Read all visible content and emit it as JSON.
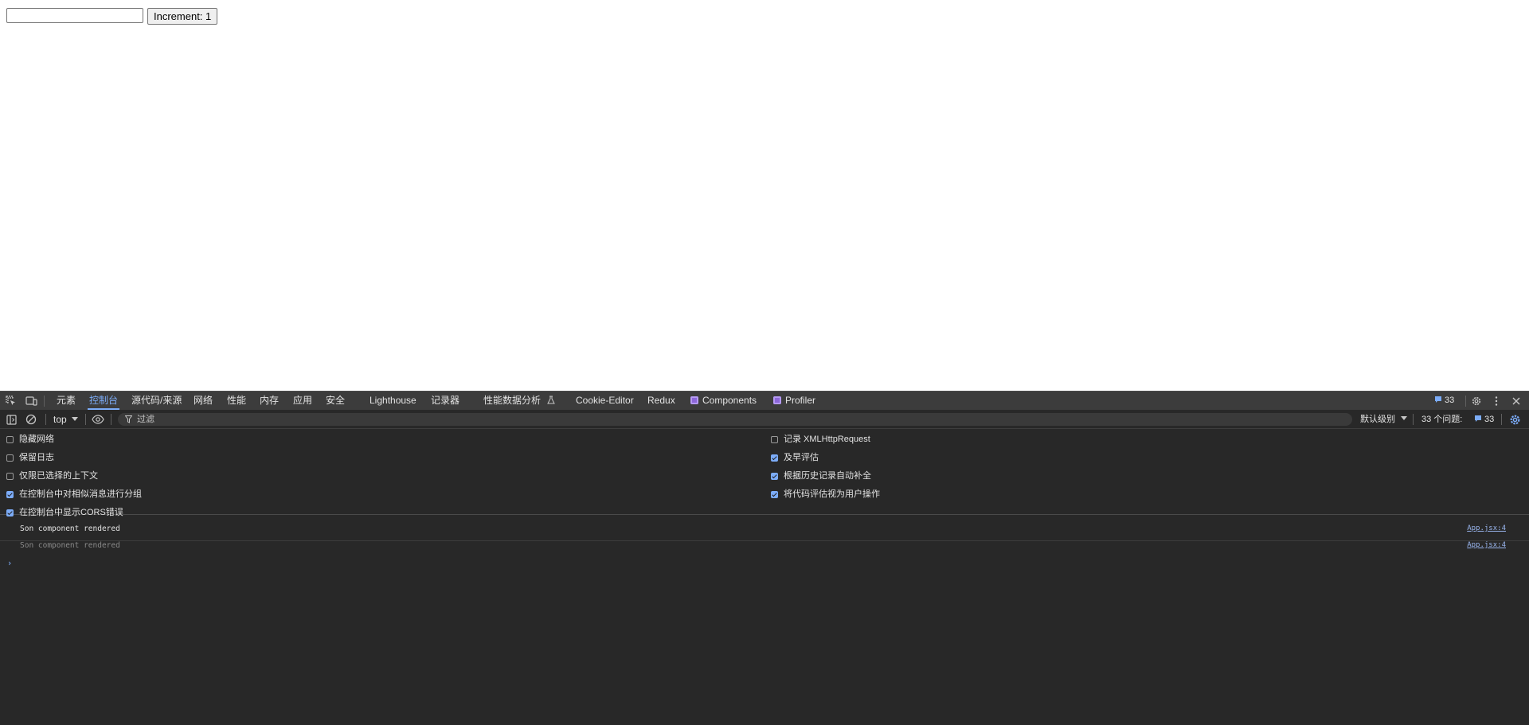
{
  "page": {
    "input_value": "",
    "button_label": "Increment: 1"
  },
  "devtools": {
    "tabs": [
      {
        "label": "元素"
      },
      {
        "label": "控制台",
        "active": true
      },
      {
        "label": "源代码/来源"
      },
      {
        "label": "网络"
      },
      {
        "label": "性能"
      },
      {
        "label": "内存"
      },
      {
        "label": "应用"
      },
      {
        "label": "安全"
      },
      {
        "label": "Lighthouse"
      },
      {
        "label": "记录器"
      },
      {
        "label": "性能数据分析"
      },
      {
        "label": "Cookie-Editor"
      },
      {
        "label": "Redux"
      },
      {
        "label": "Components"
      },
      {
        "label": "Profiler"
      }
    ],
    "issues_badge_count": "33",
    "toolbar": {
      "context": "top",
      "filter_placeholder": "过滤",
      "levels": "默认级别",
      "issues_label": "33 个问题:",
      "issues_count": "33"
    },
    "settings": {
      "left": [
        {
          "label": "隐藏网络",
          "checked": false
        },
        {
          "label": "保留日志",
          "checked": false
        },
        {
          "label": "仅限已选择的上下文",
          "checked": false
        },
        {
          "label": "在控制台中对相似消息进行分组",
          "checked": true
        },
        {
          "label": "在控制台中显示CORS错误",
          "checked": true
        }
      ],
      "right": [
        {
          "label": "记录 XMLHttpRequest",
          "checked": false
        },
        {
          "label": "及早评估",
          "checked": true
        },
        {
          "label": "根据历史记录自动补全",
          "checked": true
        },
        {
          "label": "将代码评估视为用户操作",
          "checked": true
        }
      ]
    },
    "messages": [
      {
        "text": "Son component rendered",
        "source": "App.jsx:4"
      },
      {
        "text": "Son component rendered",
        "source": "App.jsx:4"
      }
    ],
    "prompt": "›",
    "colors": {
      "accent": "#7cacf8",
      "panel_bg": "#282828",
      "tabbar_bg": "#3c3c3c"
    }
  }
}
